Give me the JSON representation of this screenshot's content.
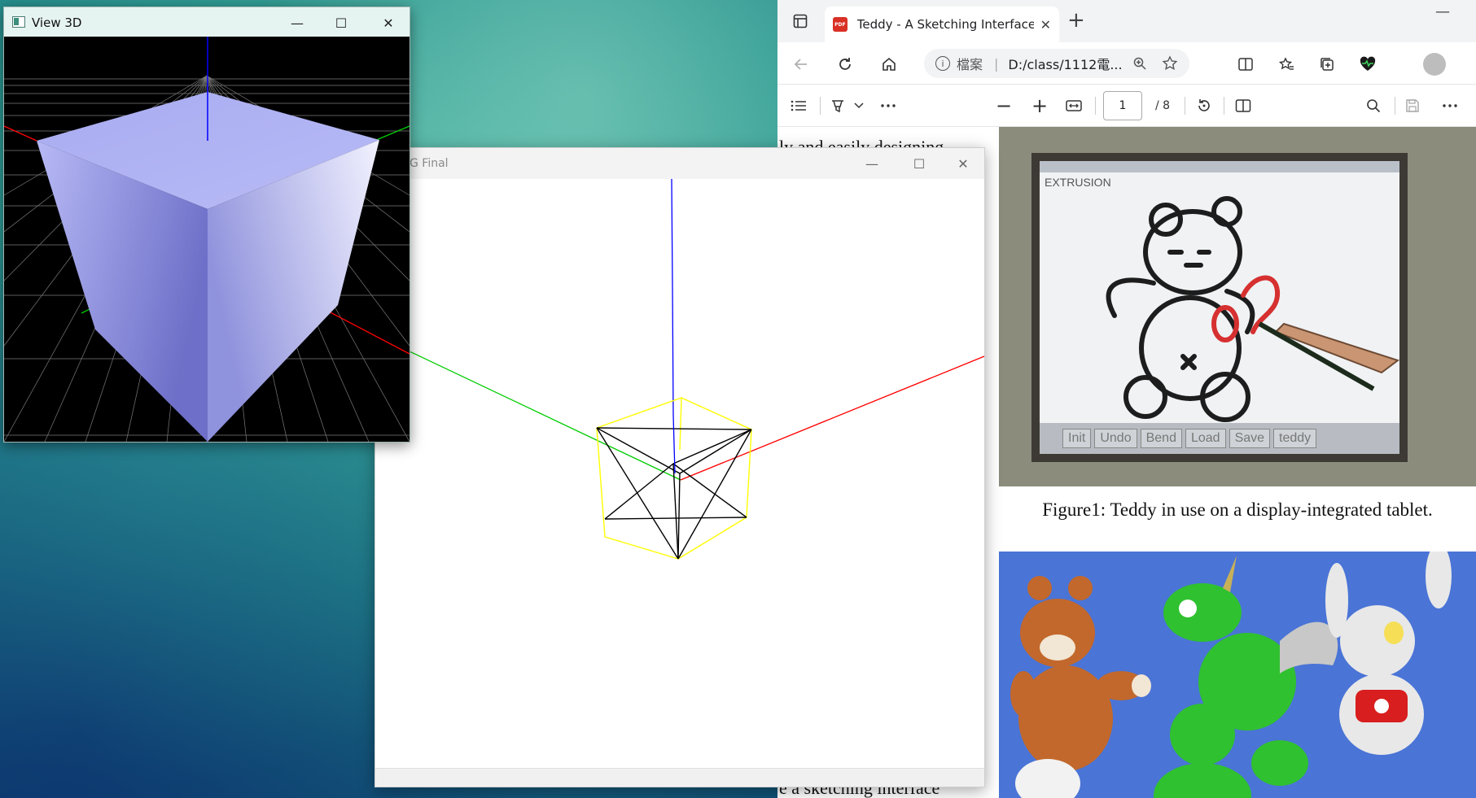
{
  "view3d_window": {
    "title": "View 3D",
    "minimize": "—",
    "maximize": "☐",
    "close": "✕"
  },
  "cg_window": {
    "title": "G Final",
    "minimize": "—",
    "maximize": "☐",
    "close": "✕"
  },
  "browser": {
    "tab_title": "Teddy - A Sketching Interface for",
    "tab_close": "✕",
    "new_tab": "+",
    "minimize": "—",
    "address_label": "檔案",
    "address_url": "D:/class/1112電...",
    "pdf_toolbar": {
      "page_number": "1",
      "page_total": "/ 8",
      "zoom_out": "−",
      "zoom_in": "+"
    },
    "pdf_content": {
      "text_top": "ly and easily designing",
      "text_bottom": "e a sketching interface",
      "figure1_ui_label": "EXTRUSION",
      "figure1_buttons": [
        "Init",
        "Undo",
        "Bend",
        "Load",
        "Save",
        "teddy"
      ],
      "figure1_caption": "Figure1: Teddy in use on a display-integrated tablet."
    }
  },
  "colors": {
    "axis_x": "#ff0000",
    "axis_y": "#00cc00",
    "axis_z": "#0000ff",
    "cube_edges": "#ffff00",
    "tetrahedron_edges": "#000000",
    "cube_face": "#b0b4f4"
  }
}
